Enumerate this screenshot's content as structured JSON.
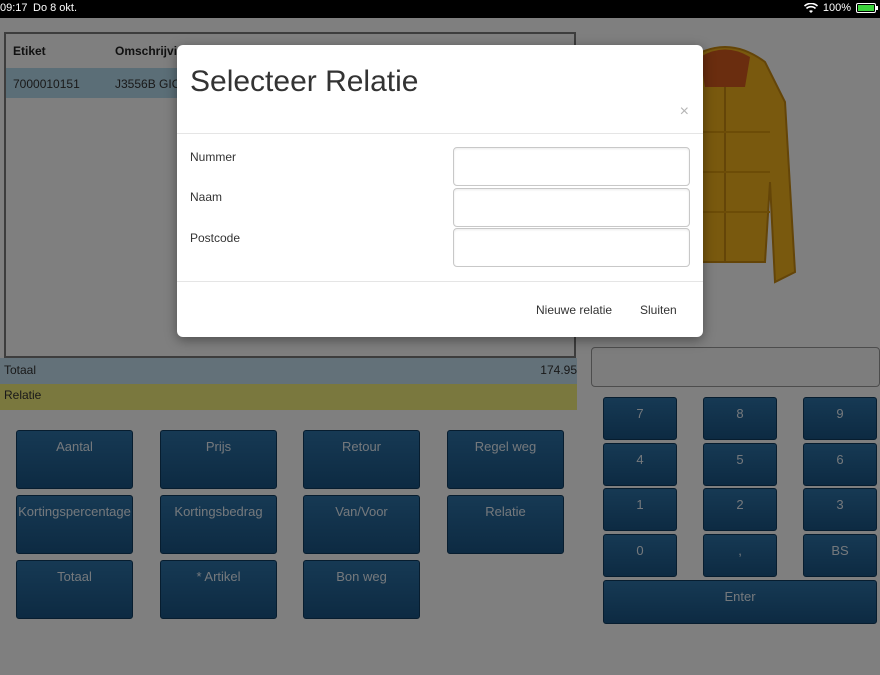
{
  "statusbar": {
    "time": "09:17",
    "date": "Do 8 okt.",
    "battery": "100%"
  },
  "table": {
    "headers": [
      "Etiket",
      "Omschrijvi"
    ],
    "row": {
      "etiket": "7000010151",
      "omschrijving": "J3556B GIO"
    }
  },
  "totaal": {
    "label": "Totaal",
    "value": "174.95"
  },
  "relatie": {
    "label": "Relatie"
  },
  "buttons": {
    "aantal": "Aantal",
    "prijs": "Prijs",
    "retour": "Retour",
    "regel_weg": "Regel weg",
    "kortingspercentage": "Kortingspercentage",
    "kortingsbedrag": "Kortingsbedrag",
    "van_voor": "Van/Voor",
    "relatie": "Relatie",
    "totaal": "Totaal",
    "artikel": "* Artikel",
    "bon_weg": "Bon weg"
  },
  "keypad": {
    "k7": "7",
    "k8": "8",
    "k9": "9",
    "k4": "4",
    "k5": "5",
    "k6": "6",
    "k1": "1",
    "k2": "2",
    "k3": "3",
    "k0": "0",
    "comma": ",",
    "bs": "BS",
    "enter": "Enter"
  },
  "modal": {
    "title": "Selecteer Relatie",
    "close": "×",
    "fields": {
      "nummer": "Nummer",
      "naam": "Naam",
      "postcode": "Postcode"
    },
    "nieuwe_relatie": "Nieuwe relatie",
    "sluiten": "Sluiten"
  },
  "colors": {
    "button": "#1a5585",
    "totaal_bar": "#c6e2f3",
    "relatie_bar": "#f5f07d",
    "row_selected": "#b7dcef"
  }
}
